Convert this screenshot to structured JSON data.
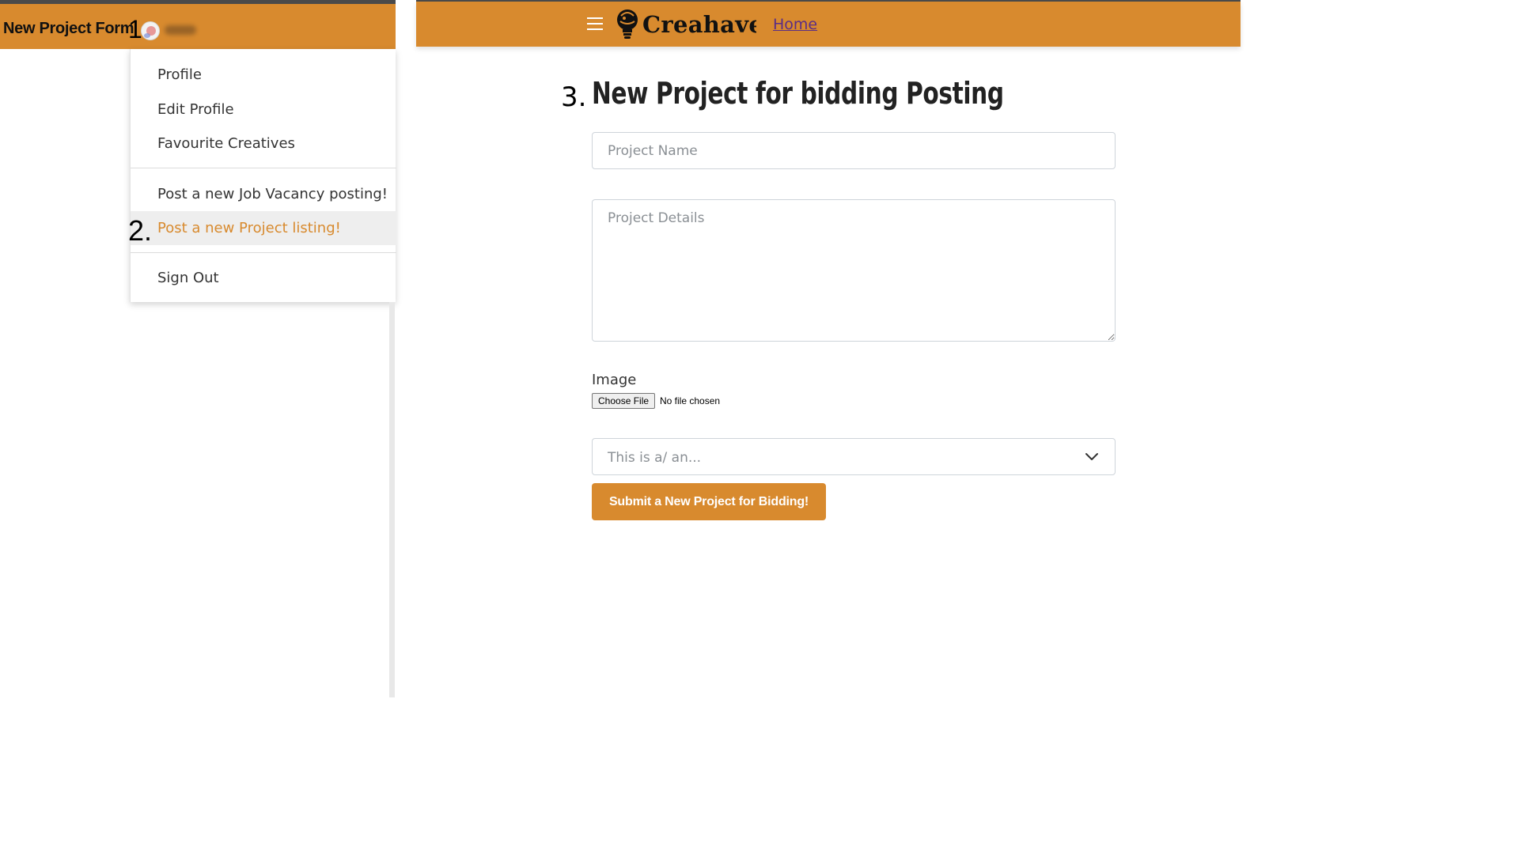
{
  "annotations": {
    "step1": "1.",
    "step2": "2.",
    "step3": "3."
  },
  "left": {
    "title": "New Project Form",
    "menu": {
      "profile": "Profile",
      "edit_profile": "Edit Profile",
      "favourites": "Favourite Creatives",
      "post_job": "Post a new Job Vacancy posting!",
      "post_project": "Post a new Project listing!",
      "sign_out": "Sign Out"
    }
  },
  "right": {
    "logo_text": "Creahaven",
    "home_link": "Home",
    "heading": "New Project for bidding Posting",
    "form": {
      "project_name_placeholder": "Project Name",
      "project_details_placeholder": "Project Details",
      "image_label": "Image",
      "choose_file": "Choose File",
      "no_file": "No file chosen",
      "type_placeholder": "This is a/ an...",
      "submit": "Submit a New Project for Bidding!"
    }
  },
  "colors": {
    "accent": "#d88a2e",
    "link": "#5b2d86",
    "active_bg": "#eeeeee"
  },
  "icons": {
    "menu": "hamburger-icon",
    "logo": "lightbulb-logo-icon",
    "avatar": "user-avatar",
    "select": "chevron-down-icon"
  }
}
